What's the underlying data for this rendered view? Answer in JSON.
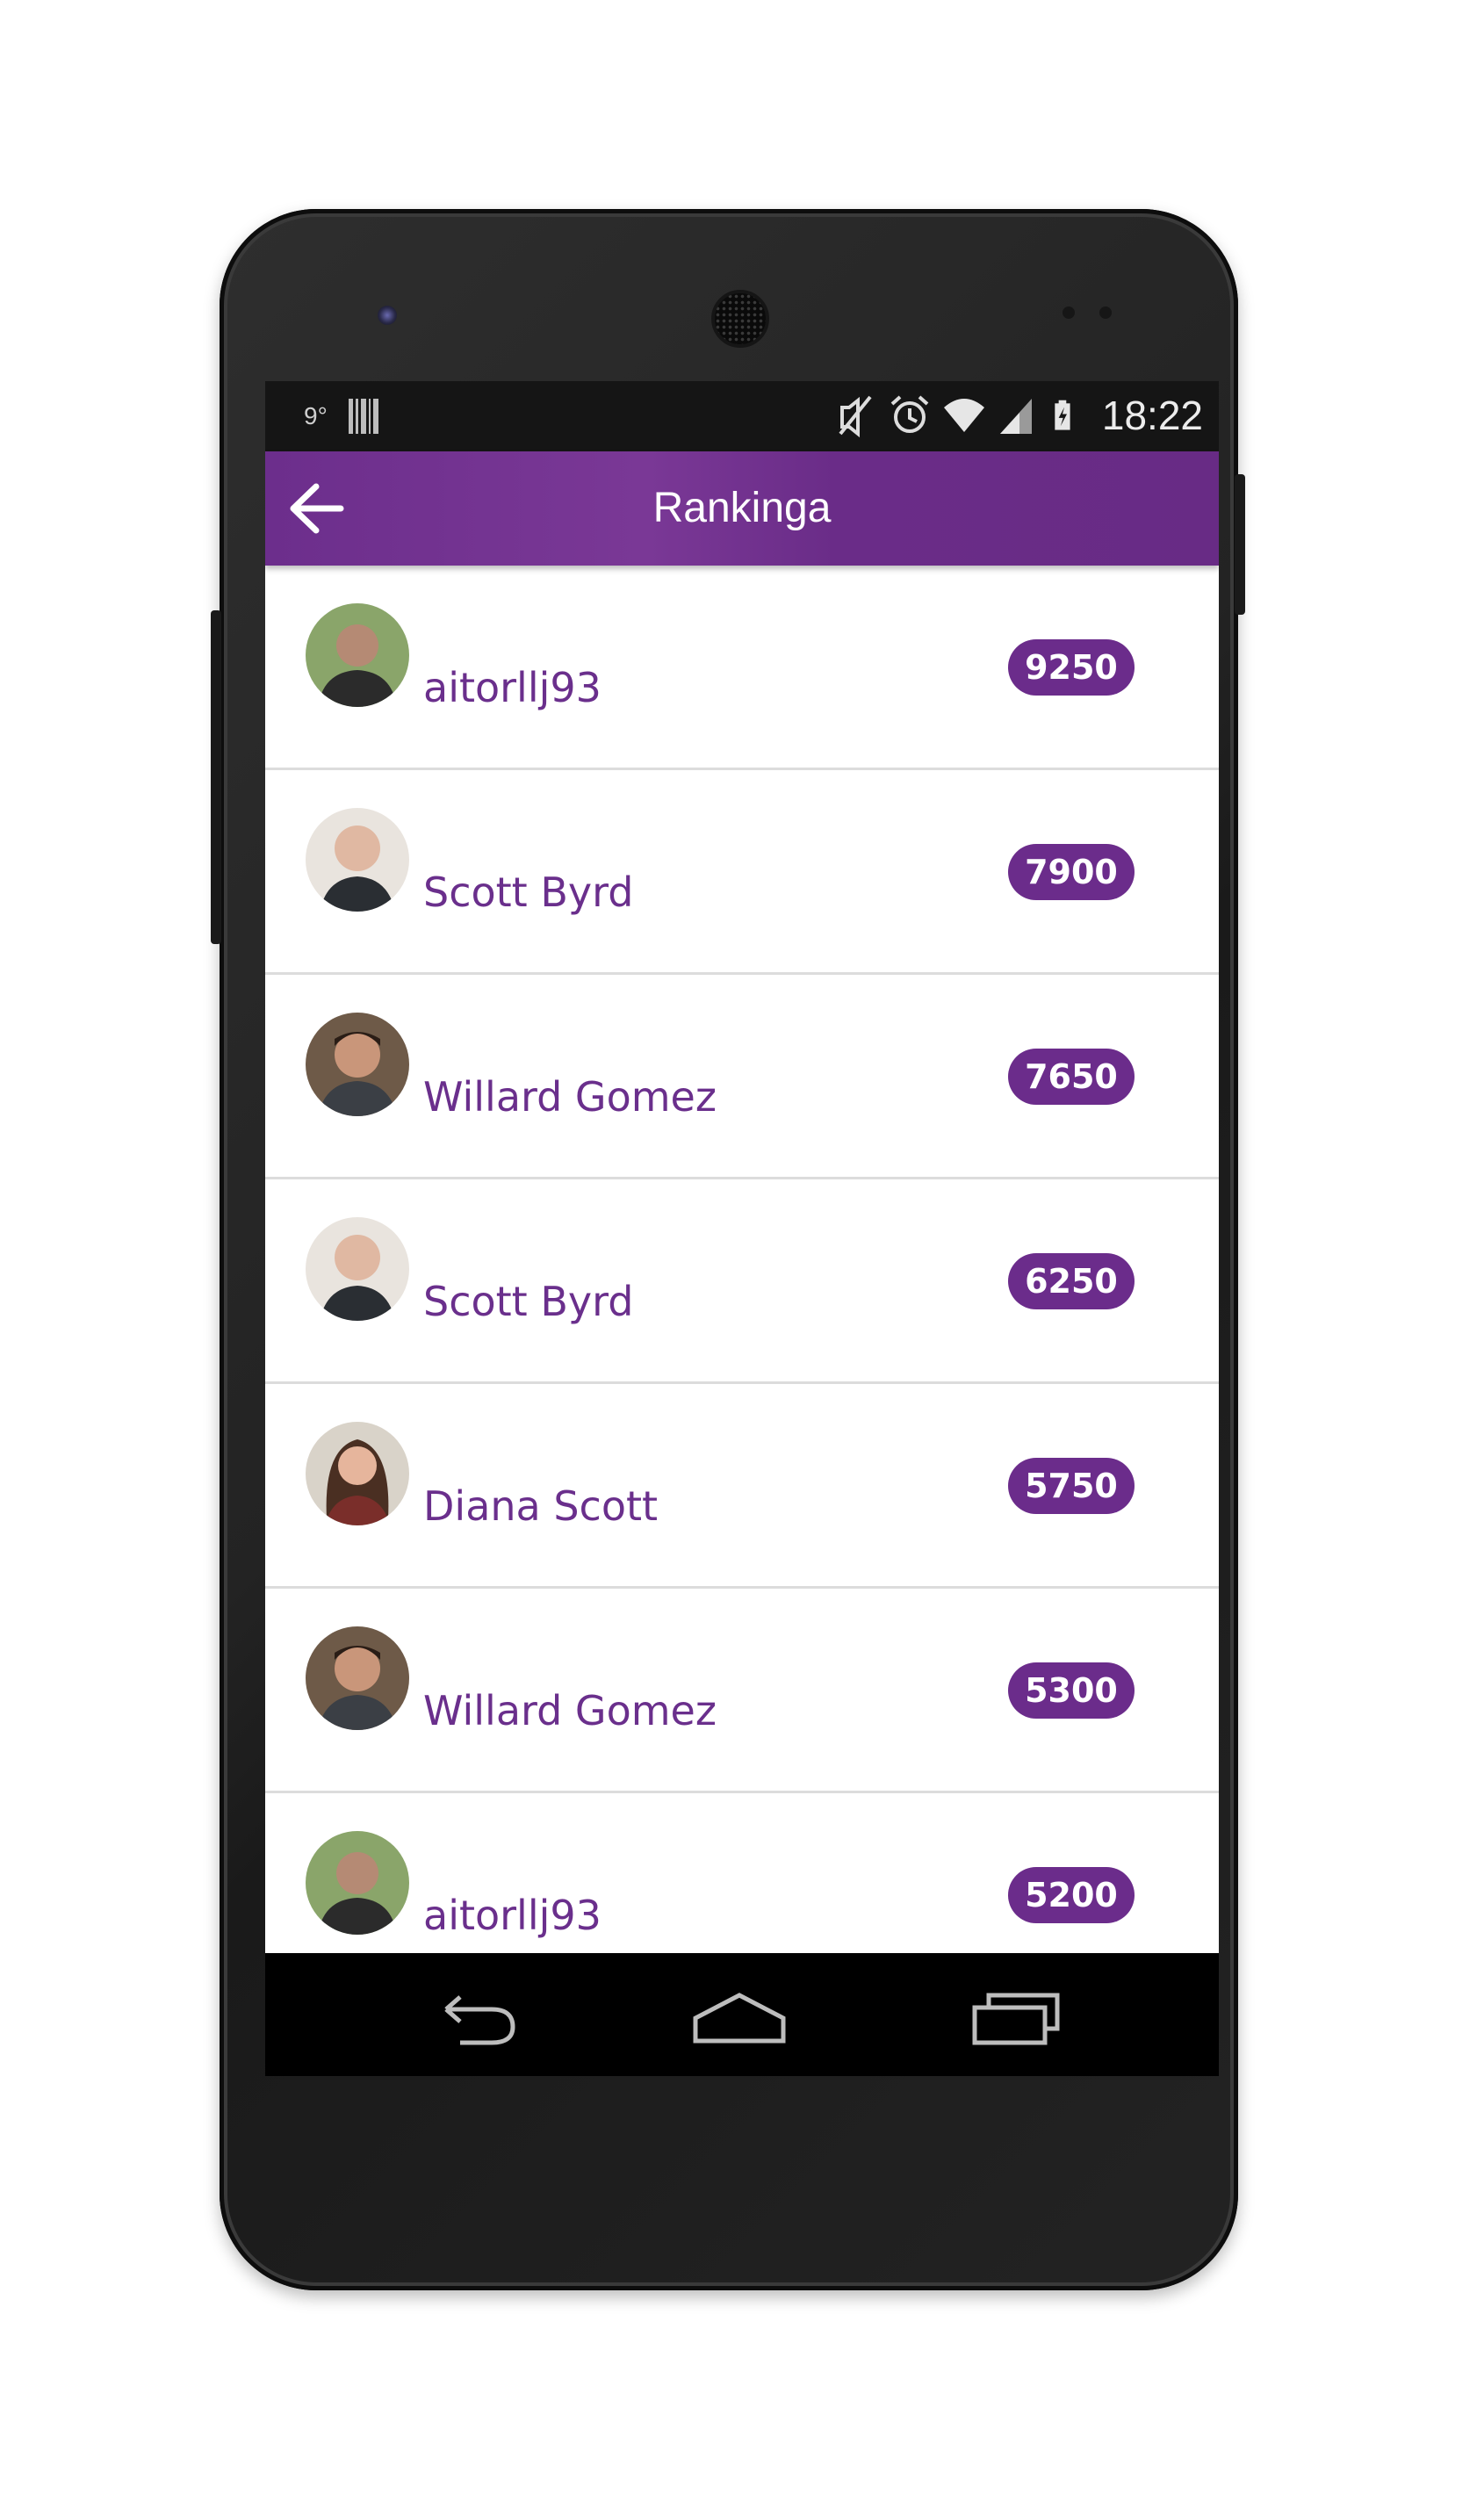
{
  "status_bar": {
    "temperature": "9°",
    "time": "18:22",
    "icons": [
      "barcode-icon",
      "mute-icon",
      "alarm-icon",
      "wifi-icon",
      "signal-icon",
      "battery-charging-icon"
    ]
  },
  "app_bar": {
    "title": "Rankinga",
    "back_icon": "arrow-left-icon"
  },
  "rankings": [
    {
      "name": "aitorllj93",
      "score": "9250",
      "avatar": "person-green"
    },
    {
      "name": "Scott Byrd",
      "score": "7900",
      "avatar": "person-bald"
    },
    {
      "name": "Willard Gomez",
      "score": "7650",
      "avatar": "person-dark"
    },
    {
      "name": "Scott Byrd",
      "score": "6250",
      "avatar": "person-bald"
    },
    {
      "name": "Diana Scott",
      "score": "5750",
      "avatar": "person-woman"
    },
    {
      "name": "Willard Gomez",
      "score": "5300",
      "avatar": "person-dark"
    },
    {
      "name": "aitorllj93",
      "score": "5200",
      "avatar": "person-green"
    }
  ],
  "nav_bar": {
    "icons": [
      "nav-back-icon",
      "nav-home-icon",
      "nav-recent-apps-icon"
    ]
  },
  "colors": {
    "accent": "#6b2c8b",
    "app_bar": "#6c2e8c",
    "name_text": "#6a2f8c"
  }
}
